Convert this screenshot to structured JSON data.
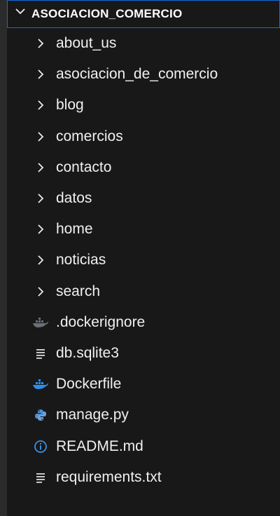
{
  "explorer": {
    "root_label": "ASOCIACION_COMERCIO",
    "folders": [
      {
        "label": "about_us"
      },
      {
        "label": "asociacion_de_comercio"
      },
      {
        "label": "blog"
      },
      {
        "label": "comercios"
      },
      {
        "label": "contacto"
      },
      {
        "label": "datos"
      },
      {
        "label": "home"
      },
      {
        "label": "noticias"
      },
      {
        "label": "search"
      }
    ],
    "files": [
      {
        "label": ".dockerignore",
        "icon": "docker-dim-icon"
      },
      {
        "label": "db.sqlite3",
        "icon": "text-lines-icon"
      },
      {
        "label": "Dockerfile",
        "icon": "docker-icon"
      },
      {
        "label": "manage.py",
        "icon": "python-icon"
      },
      {
        "label": "README.md",
        "icon": "info-icon"
      },
      {
        "label": "requirements.txt",
        "icon": "text-lines-icon"
      }
    ],
    "colors": {
      "background": "#181818",
      "focus_border": "#0d6de0",
      "docker": "#2f8ded",
      "python": "#4d8fd1",
      "info": "#3b8fe0"
    }
  }
}
